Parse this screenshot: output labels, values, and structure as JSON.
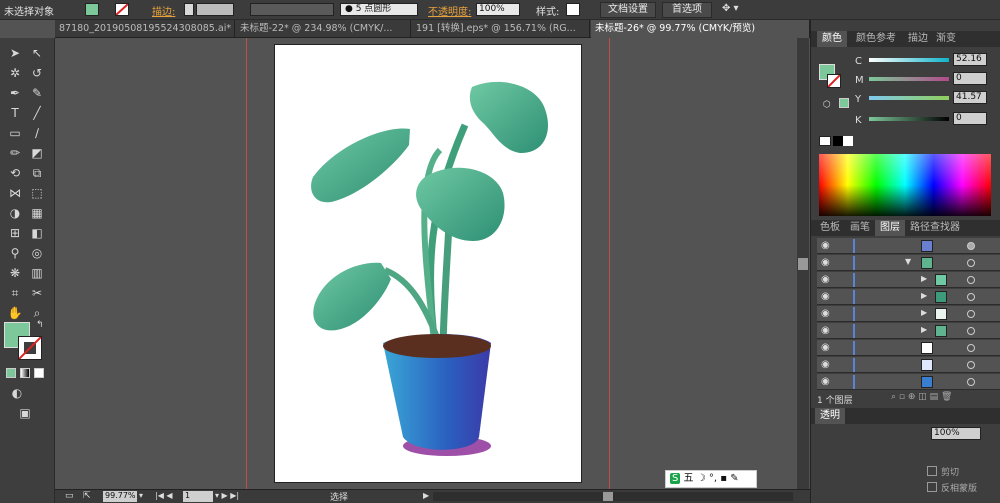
{
  "control_bar": {
    "selection": "未选择对象",
    "stroke_label": "描边:",
    "brush": "5 点圆形",
    "opacity_label": "不透明度:",
    "opacity_value": "100%",
    "style_label": "样式:",
    "doc_setup": "文档设置",
    "preferences": "首选项"
  },
  "tabs": [
    {
      "label": "87180_2019050819552430808​5.ai*"
    },
    {
      "label": "未标题-22* @ 234.98% (CMYK/..."
    },
    {
      "label": "191 [转换].eps* @ 156.71% (RG..."
    },
    {
      "label": "未标题-26* @ 99.77% (CMYK/预览)"
    }
  ],
  "color_panel": {
    "tabs": [
      "颜色",
      "颜色参考",
      "描边",
      "渐变"
    ],
    "channels": [
      {
        "name": "C",
        "value": "52.16"
      },
      {
        "name": "M",
        "value": "0"
      },
      {
        "name": "Y",
        "value": "41.57"
      },
      {
        "name": "K",
        "value": "0"
      }
    ],
    "fill_color": "#7dc89a"
  },
  "layers_panel": {
    "tabs": [
      "色板",
      "画笔",
      "图层",
      "路径查找器"
    ],
    "footer": "1 个图层"
  },
  "lower_panel": {
    "tab": "透明",
    "opacity": "100%",
    "btn1": "剪切",
    "btn2": "反相蒙版"
  },
  "status_bar": {
    "zoom": "99.77%",
    "page": "1",
    "tool": "选择"
  },
  "ime": {
    "label": "五"
  }
}
